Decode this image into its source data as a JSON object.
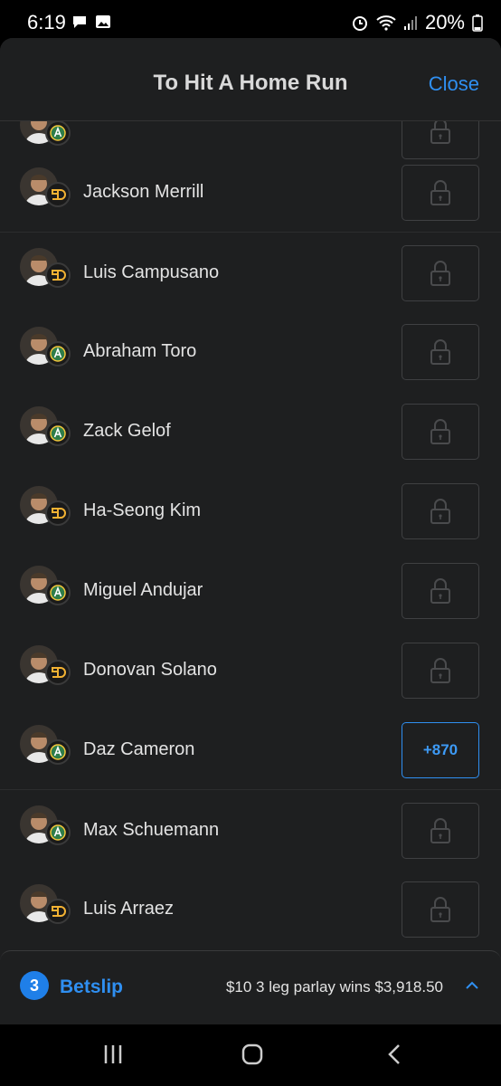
{
  "status_bar": {
    "time": "6:19",
    "battery": "20%",
    "icons": [
      "chat-icon",
      "image-icon",
      "alarm-icon",
      "wifi-icon",
      "signal-icon",
      "battery-icon"
    ]
  },
  "header": {
    "title": "To Hit A Home Run",
    "close_label": "Close"
  },
  "players": [
    {
      "name": "",
      "team": "athletics",
      "odds": "",
      "locked": true
    },
    {
      "name": "Jackson Merrill",
      "team": "padres",
      "odds": "",
      "locked": true
    },
    {
      "name": "Luis Campusano",
      "team": "padres",
      "odds": "",
      "locked": true
    },
    {
      "name": "Abraham Toro",
      "team": "athletics",
      "odds": "",
      "locked": true
    },
    {
      "name": "Zack Gelof",
      "team": "athletics",
      "odds": "",
      "locked": true
    },
    {
      "name": "Ha-Seong Kim",
      "team": "padres",
      "odds": "",
      "locked": true
    },
    {
      "name": "Miguel Andujar",
      "team": "athletics",
      "odds": "",
      "locked": true
    },
    {
      "name": "Donovan Solano",
      "team": "padres",
      "odds": "",
      "locked": true
    },
    {
      "name": "Daz Cameron",
      "team": "athletics",
      "odds": "+870",
      "locked": false
    },
    {
      "name": "Max Schuemann",
      "team": "athletics",
      "odds": "",
      "locked": true
    },
    {
      "name": "Luis Arraez",
      "team": "padres",
      "odds": "",
      "locked": true
    }
  ],
  "betslip": {
    "count": "3",
    "label": "Betslip",
    "summary": "$10 3 leg parlay wins $3,918.50"
  },
  "colors": {
    "accent": "#2f8ff1",
    "background": "#1e1f20",
    "padres": "#f2b233",
    "athletics": "#2e7d4a"
  }
}
